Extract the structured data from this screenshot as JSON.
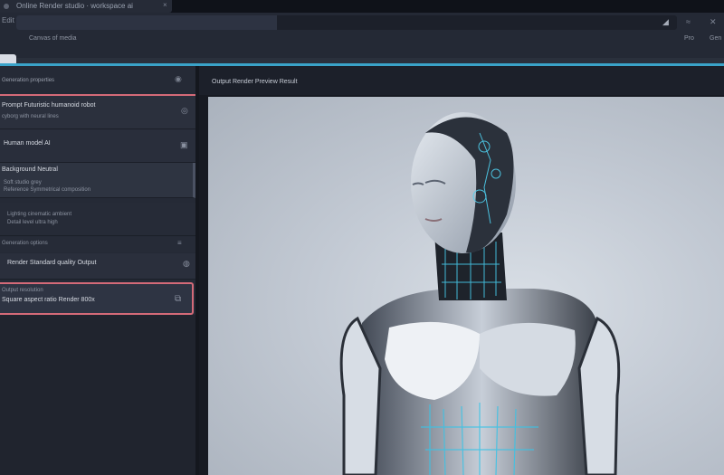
{
  "browser": {
    "tab_title": "Online Render studio · workspace ai",
    "tab_close": "×",
    "nav_label": "Edit",
    "bookmark_label": "Canvas of media",
    "right_icon_1": "◢",
    "right_icon_2": "≈",
    "right_icon_3": "✕",
    "bookmark_btn_1": "Pro",
    "bookmark_btn_2": "Gen"
  },
  "sidebar": {
    "header_label": "Generation properties",
    "header_icon": "◉",
    "cards": [
      {
        "title": "Prompt  Futuristic humanoid robot",
        "sub": "cyborg with neural lines",
        "icon": "◎"
      },
      {
        "title": "Human model AI",
        "icon": "▣"
      },
      {
        "title": "Background Neutral",
        "sub": "Soft studio grey",
        "sub2": "Reference   Symmetrical composition"
      },
      {
        "sub": "Lighting cinematic ambient",
        "sub2": "Detail level ultra high"
      },
      {
        "sub": "Generation options",
        "icon": "≡"
      },
      {
        "title": "Render  Standard quality  Output",
        "icon": "◍"
      },
      {
        "sub": "Output resolution",
        "title": "Square aspect ratio   Render  800x"
      }
    ]
  },
  "main": {
    "title": "Output Render  Preview  Result"
  },
  "colors": {
    "accent_line": "#3aa3c9",
    "selection_border": "#d46a78"
  }
}
